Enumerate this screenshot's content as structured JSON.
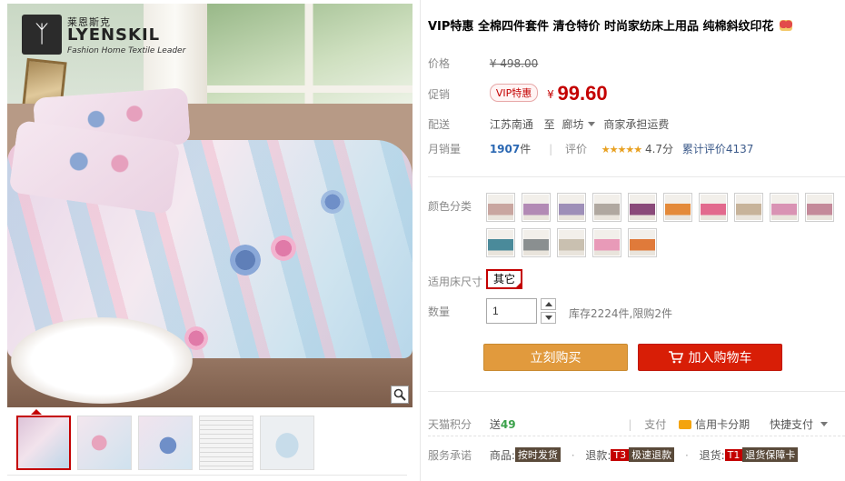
{
  "brand": {
    "name_cn": "莱恩斯克",
    "name_en": "LYENSKIL",
    "tagline": "Fashion Home Textile Leader"
  },
  "product": {
    "title": "VIP特惠 全棉四件套件 清仓特价 时尚家纺床上用品 纯棉斜纹印花"
  },
  "price": {
    "label": "价格",
    "original": "¥ 498.00"
  },
  "promo": {
    "label": "促销",
    "badge": "VIP特惠",
    "currency": "¥",
    "value": "99.60"
  },
  "shipping": {
    "label": "配送",
    "from": "江苏南通",
    "to_word": "至",
    "to": "廊坊",
    "fee_note": "商家承担运费"
  },
  "sales": {
    "label": "月销量",
    "count": "1907",
    "unit": "件",
    "rating_label": "评价",
    "stars": "★★★★★",
    "score": "4.7分",
    "review_total": "累计评价4137"
  },
  "colors": {
    "label": "颜色分类",
    "swatches": [
      {
        "accent": "#c9a6a0"
      },
      {
        "accent": "#b28ab5"
      },
      {
        "accent": "#9e8fb8"
      },
      {
        "accent": "#b0a8a0"
      },
      {
        "accent": "#8a4a7a"
      },
      {
        "accent": "#e48a3a"
      },
      {
        "accent": "#e26a8e"
      },
      {
        "accent": "#c7b39a"
      },
      {
        "accent": "#d993b4"
      },
      {
        "accent": "#c48a9a"
      },
      {
        "accent": "#4a8a9a"
      },
      {
        "accent": "#8a8f90"
      },
      {
        "accent": "#c9c0b0"
      },
      {
        "accent": "#e89ab8"
      },
      {
        "accent": "#e07a3a"
      }
    ]
  },
  "size": {
    "label": "适用床尺寸",
    "selected": "其它"
  },
  "quantity": {
    "label": "数量",
    "value": "1",
    "stock_note": "库存2224件,限购2件"
  },
  "actions": {
    "buy_now": "立刻购买",
    "add_to_cart": "加入购物车"
  },
  "points": {
    "label": "天猫积分",
    "prefix": "送",
    "value": "49",
    "pay_label": "支付",
    "credit": "信用卡分期",
    "quick_pay": "快捷支付"
  },
  "service": {
    "label": "服务承诺",
    "item1_prefix": "商品:",
    "item1_tag": "按时发货",
    "item2_prefix": "退款:",
    "item2_code": "T3",
    "item2_tag": "极速退款",
    "item3_prefix": "退货:",
    "item3_code": "T1",
    "item3_tag": "退货保障卡"
  },
  "theme": {
    "accent_red": "#c40000",
    "buy_orange": "#e19a3d",
    "cart_red": "#d81e06",
    "link_blue": "#2b68b3",
    "points_green": "#3aa14a"
  }
}
